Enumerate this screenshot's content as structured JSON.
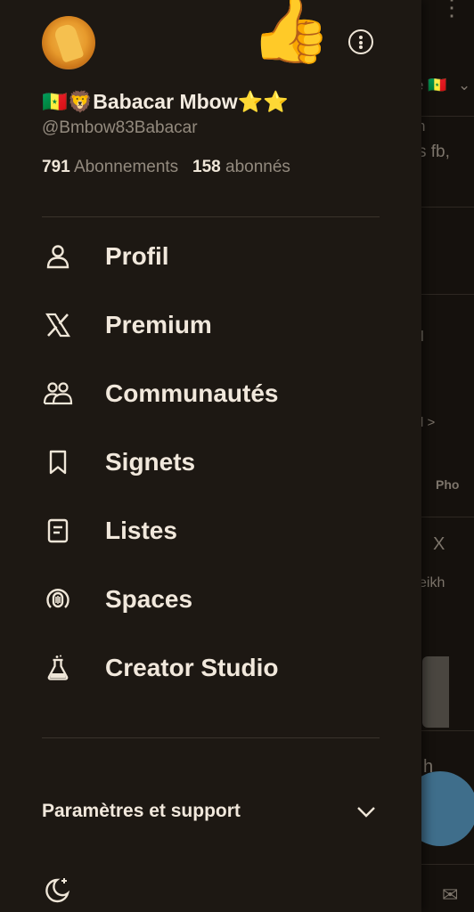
{
  "profile": {
    "name": "🇸🇳🦁Babacar Mbow⭐⭐",
    "handle": "@Bmbow83Babacar",
    "following_count": "791",
    "following_label": "Abonnements",
    "followers_count": "158",
    "followers_label": "abonnés"
  },
  "decorations": {
    "thumbs": "👍"
  },
  "nav": {
    "items": [
      {
        "label": "Profil",
        "icon": "person-icon"
      },
      {
        "label": "Premium",
        "icon": "x-logo-icon"
      },
      {
        "label": "Communautés",
        "icon": "communities-icon"
      },
      {
        "label": "Signets",
        "icon": "bookmark-icon"
      },
      {
        "label": "Listes",
        "icon": "list-icon"
      },
      {
        "label": "Spaces",
        "icon": "spaces-icon"
      },
      {
        "label": "Creator Studio",
        "icon": "flask-icon"
      }
    ]
  },
  "settings": {
    "label": "Paramètres et support"
  },
  "background": {
    "snippets": [
      "é 🇸🇳",
      "n",
      "s fb,",
      "l",
      "l >",
      "Pho",
      "X",
      "eikh",
      "h"
    ]
  },
  "colors": {
    "background": "#1d1813",
    "text": "#efe6d8",
    "muted": "#938a7e",
    "fab": "#3f6e8b"
  }
}
